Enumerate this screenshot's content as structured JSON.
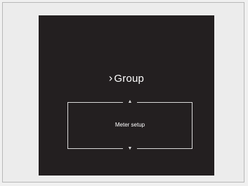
{
  "header": {
    "chevron": "›",
    "title": "Group"
  },
  "menu": {
    "item_label": "Meter setup",
    "up_arrow": "▲",
    "down_arrow": "▼"
  },
  "icons": [
    "chevron-right-icon",
    "arrow-up-icon",
    "arrow-down-icon"
  ],
  "colors": {
    "screen_bg": "#231f20",
    "text": "#ffffff",
    "frame_border": "#b8b8b8"
  }
}
